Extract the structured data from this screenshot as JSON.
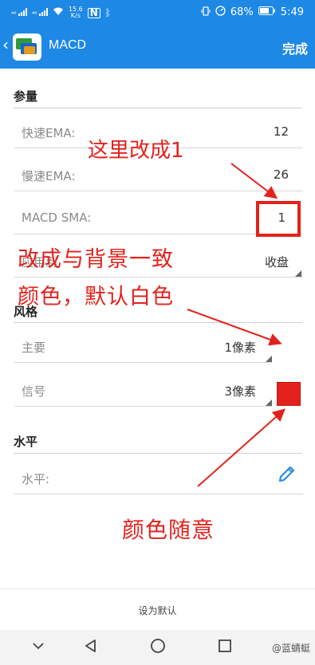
{
  "status_bar": {
    "network_left": "⁴⁶",
    "speed_value": "15.6",
    "speed_unit": "K/s",
    "battery": "68%",
    "time": "5:49"
  },
  "appbar": {
    "title": "MACD",
    "done_label": "完成"
  },
  "sections": {
    "params": {
      "header": "参量"
    },
    "style": {
      "header": "风格"
    },
    "level": {
      "header": "水平"
    }
  },
  "fields": {
    "fast_ema": {
      "label": "快速EMA:",
      "value": "12"
    },
    "slow_ema": {
      "label": "慢速EMA:",
      "value": "26"
    },
    "macd_sma": {
      "label": "MACD SMA:",
      "value": "1"
    },
    "apply_to": {
      "label": "应用到",
      "value": "收盘"
    },
    "main": {
      "label": "主要",
      "value": "1像素",
      "color": "#ffffff"
    },
    "signal": {
      "label": "信号",
      "value": "3像素",
      "color": "#e3211c"
    },
    "level": {
      "label": "水平:"
    }
  },
  "annotations": {
    "note1": "这里改成1",
    "note2_line1": "改成与背景一致",
    "note2_line2": "颜色，默认白色",
    "note3": "颜色随意"
  },
  "footer": {
    "set_default": "设为默认"
  },
  "watermark": "@蓝蜻蜓",
  "colors": {
    "primary": "#1e88e5",
    "annotation": "#e3211c",
    "pencil": "#1e88e5"
  },
  "icons": {
    "back": "chevron-left-icon",
    "pencil": "pencil-icon",
    "nav_back": "triangle-back-icon",
    "nav_home": "circle-home-icon",
    "nav_recent": "square-recent-icon",
    "nav_down": "chevron-down-icon"
  }
}
